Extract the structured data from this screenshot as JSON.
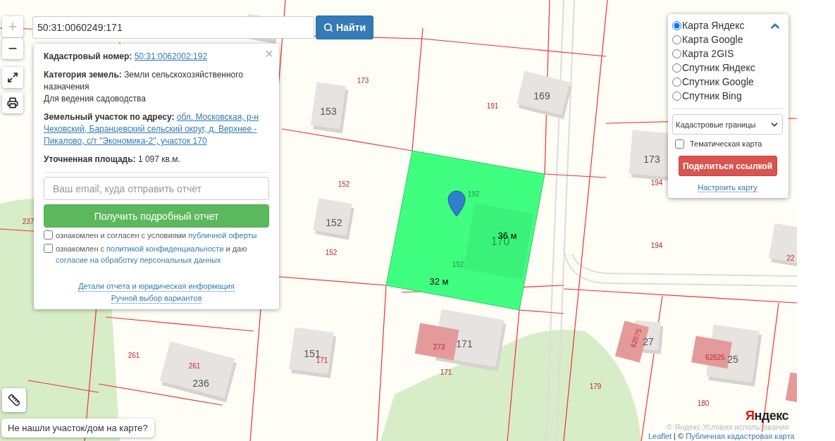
{
  "search": {
    "value": "50:31:0060249:171",
    "button": "Найти"
  },
  "zoom": {
    "in": "+",
    "out": "−"
  },
  "popup": {
    "close": "×",
    "cadastral_number": {
      "label": "Кадастровый номер:",
      "value": "50:31:0062002:192"
    },
    "category": {
      "label": "Категория земель:",
      "value": "Земли сельскохозяйственного назначения",
      "use": "Для ведения садоводства"
    },
    "address": {
      "label": "Земельный участок по адресу:",
      "value_lines": [
        "обл. Московская, р-н",
        "Чеховский, Баранцевский сельский округ, д. Верхнее -",
        "Пикалово, с/т \"Экономика-2\", участок 170"
      ]
    },
    "area": {
      "label": "Уточненная площадь:",
      "value": "1 097 кв.м."
    },
    "email": {
      "placeholder": "Ваш email, куда отправить отчет"
    },
    "submit": "Получить подробный отчет",
    "consents": [
      {
        "checked": false,
        "parts": [
          {
            "text": "ознакомлен и согласен с условиями ",
            "kind": "text"
          },
          {
            "text": "публичной оферты",
            "kind": "link"
          }
        ]
      },
      {
        "checked": false,
        "parts": [
          {
            "text": "ознакомлен с ",
            "kind": "text"
          },
          {
            "text": "политикой конфиденциальности",
            "kind": "link"
          },
          {
            "text": " и даю ",
            "kind": "text"
          },
          {
            "text": "согласие на обработку персональных данных",
            "kind": "link"
          }
        ]
      }
    ],
    "links": [
      "Детали отчета и юридическая информация",
      "Ручной выбор вариантов"
    ]
  },
  "layers": {
    "base_layers": [
      {
        "label": "Карта Яндекс",
        "selected": true
      },
      {
        "label": "Карта Google",
        "selected": false
      },
      {
        "label": "Карта 2GIS",
        "selected": false
      },
      {
        "label": "Спутник Яндекс",
        "selected": false
      },
      {
        "label": "Спутник Google",
        "selected": false
      },
      {
        "label": "Спутник Bing",
        "selected": false
      }
    ],
    "overlay_select": {
      "value": "Кадастровые границы"
    },
    "thematic": {
      "label": "Тематическая карта",
      "checked": false
    },
    "share": "Поделиться ссылкой",
    "settings": "Настроить карту"
  },
  "not_found": "Не нашли участок/дом на карте?",
  "map": {
    "measurements": [
      "36 м",
      "32 м"
    ],
    "parcel_labels": [
      "173",
      "191",
      "152",
      "152",
      "237",
      "194",
      "194",
      "192",
      "192",
      "261",
      "261",
      "171",
      "171",
      "273",
      "179",
      "180",
      "62575",
      "62625",
      "22"
    ],
    "building_labels": [
      "153",
      "169",
      "152",
      "173",
      "170",
      "151",
      "171",
      "236",
      "27",
      "25"
    ],
    "logo": "Яндекс",
    "yandex_attribution": "© Яндекс  Условия использования",
    "attribution": {
      "link": "Leaflet",
      "text": " | © ",
      "source": "Публичная кадастровая карта"
    }
  }
}
